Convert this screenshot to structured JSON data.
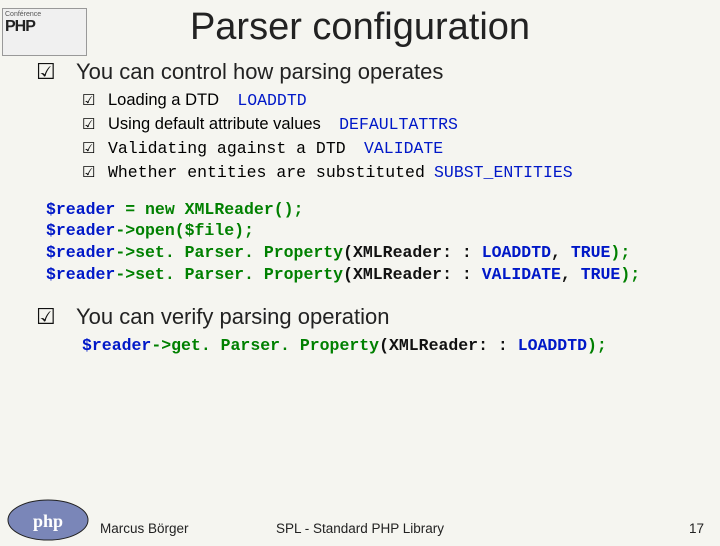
{
  "badge": {
    "line1": "Conférence",
    "line2": "PHP"
  },
  "title": "Parser configuration",
  "section1": {
    "heading": "You can control how parsing operates",
    "items": [
      {
        "text": "Loading a DTD",
        "const": "LOADDTD"
      },
      {
        "text": "Using default attribute values",
        "const": "DEFAULTATTRS"
      },
      {
        "text": "Validating against a DTD",
        "const": "VALIDATE",
        "mono": true
      },
      {
        "text": "Whether entities are substituted",
        "const": "SUBST_ENTITIES",
        "mono": true
      }
    ]
  },
  "code1": {
    "l1": {
      "var": "$reader",
      "rest": " = new XMLReader();"
    },
    "l2": {
      "var": "$reader",
      "rest": "->open($file);"
    },
    "l3": {
      "var": "$reader",
      "meth": "->set. Parser. Property",
      "open": "(XMLReader: : ",
      "cst": "LOADDTD",
      "mid": ", ",
      "arg": "TRUE",
      "close": ");"
    },
    "l4": {
      "var": "$reader",
      "meth": "->set. Parser. Property",
      "open": "(XMLReader: : ",
      "cst": "VALIDATE",
      "mid": ", ",
      "arg": "TRUE",
      "close": ");"
    }
  },
  "section2": {
    "heading": "You can verify parsing operation",
    "code": {
      "var": "$reader",
      "meth": "->get. Parser. Property",
      "open": "(XMLReader: : ",
      "cst": "LOADDTD",
      "close": ");"
    }
  },
  "footer": {
    "author": "Marcus Börger",
    "center": "SPL - Standard PHP Library",
    "page": "17"
  }
}
